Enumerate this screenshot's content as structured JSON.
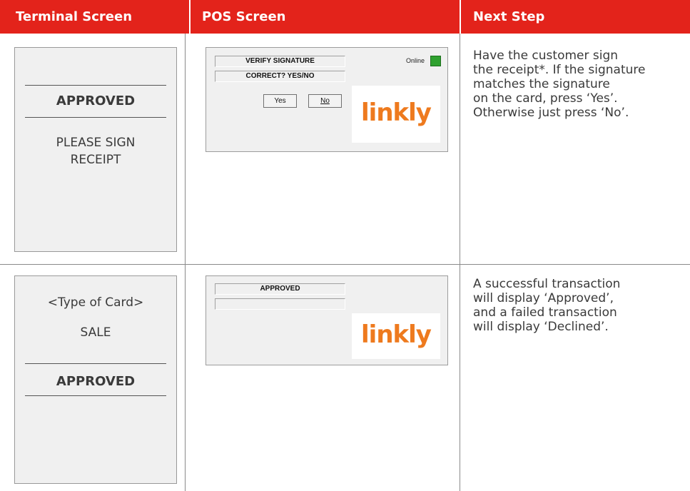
{
  "headers": {
    "terminal": "Terminal Screen",
    "pos": "POS Screen",
    "next": "Next Step"
  },
  "rows": [
    {
      "terminal": {
        "status": "APPROVED",
        "message_line1": "PLEASE SIGN",
        "message_line2": "RECEIPT"
      },
      "pos": {
        "field1": "VERIFY SIGNATURE",
        "field2": "CORRECT?  YES/NO",
        "online_label": "Online",
        "online_color": "#2fa12f",
        "yes_button": "Yes",
        "no_button": "No",
        "logo": "linkly"
      },
      "next_step": [
        "Have the customer sign",
        "the receipt*. If the signature",
        "matches the signature",
        "on the card, press ‘Yes’.",
        "Otherwise just press ‘No’."
      ]
    },
    {
      "terminal": {
        "card_type": "<Type of Card>",
        "transaction": "SALE",
        "status": "APPROVED"
      },
      "pos": {
        "field1": "APPROVED",
        "field2": "",
        "logo": "linkly"
      },
      "next_step": [
        "A successful transaction",
        "will display ‘Approved’,",
        "and a failed transaction",
        "will display ‘Declined’."
      ]
    }
  ],
  "colors": {
    "header_bg": "#e3231b",
    "logo": "#ee7a1e"
  }
}
